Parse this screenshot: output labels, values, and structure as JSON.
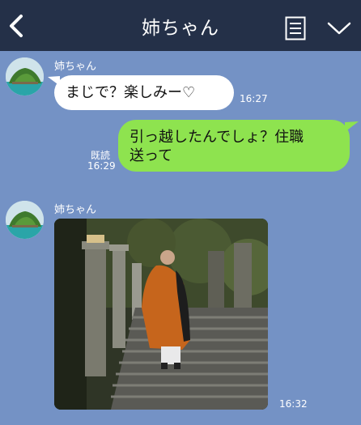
{
  "header": {
    "title": "姉ちゃん",
    "back_icon": "chevron-left-icon",
    "menu_icon": "note-list-icon",
    "collapse_icon": "chevron-down-icon"
  },
  "messages": [
    {
      "sender": "姉ちゃん",
      "text": "まじで？楽しみー♡",
      "time": "16:27",
      "direction": "incoming"
    },
    {
      "direction": "outgoing",
      "text_line1": "引っ越したんでしょ？住職",
      "text_line2": "送って",
      "read_label": "既読",
      "time": "16:29"
    },
    {
      "sender": "姉ちゃん",
      "type": "image",
      "time": "16:32",
      "direction": "incoming"
    }
  ],
  "colors": {
    "background": "#7492c5",
    "header": "#243048",
    "incoming_bubble": "#ffffff",
    "outgoing_bubble": "#8ee34f"
  }
}
